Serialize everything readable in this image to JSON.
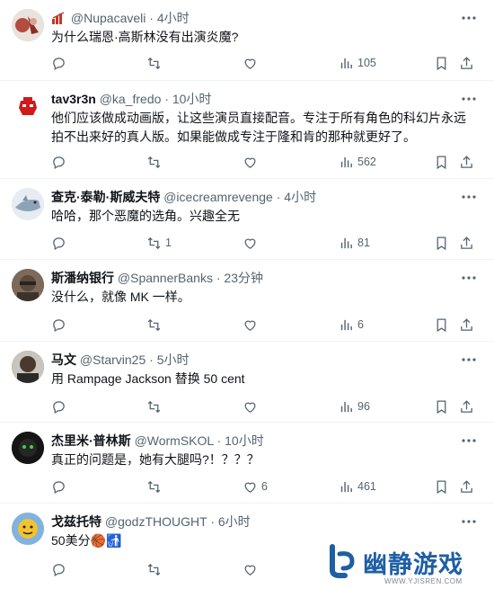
{
  "tweets": [
    {
      "name": "",
      "handle": "@Nupacaveli",
      "time": "4小时",
      "text": "为什么瑞恩·高斯林没有出演炎魔?",
      "replies": "",
      "retweets": "",
      "likes": "",
      "views": "105",
      "avatar_color": "#b34b3f"
    },
    {
      "name": "tav3r3n",
      "handle": "@ka_fredo",
      "time": "10小时",
      "text": "他们应该做成动画版，让这些演员直接配音。专注于所有角色的科幻片永远拍不出来好的真人版。如果能做成专注于隆和肯的那种就更好了。",
      "replies": "",
      "retweets": "",
      "likes": "",
      "views": "562",
      "avatar_color": "#d11a1a"
    },
    {
      "name": "查克·泰勒·斯威夫特",
      "handle": "@icecreamrevenge",
      "time": "4小时",
      "text": "哈哈，那个恶魔的选角。兴趣全无",
      "replies": "",
      "retweets": "1",
      "likes": "",
      "views": "81",
      "avatar_color": "#8fa3b8"
    },
    {
      "name": "斯潘纳银行",
      "handle": "@SpannerBanks",
      "time": "23分钟",
      "text": "没什么，就像 MK 一样。",
      "replies": "",
      "retweets": "",
      "likes": "",
      "views": "6",
      "avatar_color": "#5b4a3e"
    },
    {
      "name": "马文",
      "handle": "@Starvin25",
      "time": "5小时",
      "text": "用 Rampage Jackson 替换 50 cent",
      "replies": "",
      "retweets": "",
      "likes": "",
      "views": "96",
      "avatar_color": "#6b5a4c"
    },
    {
      "name": "杰里米·普林斯",
      "handle": "@WormSKOL",
      "time": "10小时",
      "text": "真正的问题是，她有大腿吗?！？？？",
      "replies": "",
      "retweets": "",
      "likes": "6",
      "views": "461",
      "avatar_color": "#1a1a1a"
    },
    {
      "name": "戈兹托特",
      "handle": "@godzTHOUGHT",
      "time": "6小时",
      "text": "50美分🏀🚮",
      "replies": "",
      "retweets": "",
      "likes": "",
      "views": "",
      "avatar_color": "#f2c230"
    }
  ],
  "separator": "·",
  "watermark": {
    "text": "幽静游戏",
    "url": "WWW.YJISREN.COM"
  },
  "colors": {
    "text": "#0f1419",
    "secondary": "#536471",
    "border": "#eff3f4",
    "watermark": "#1e5fa3"
  }
}
